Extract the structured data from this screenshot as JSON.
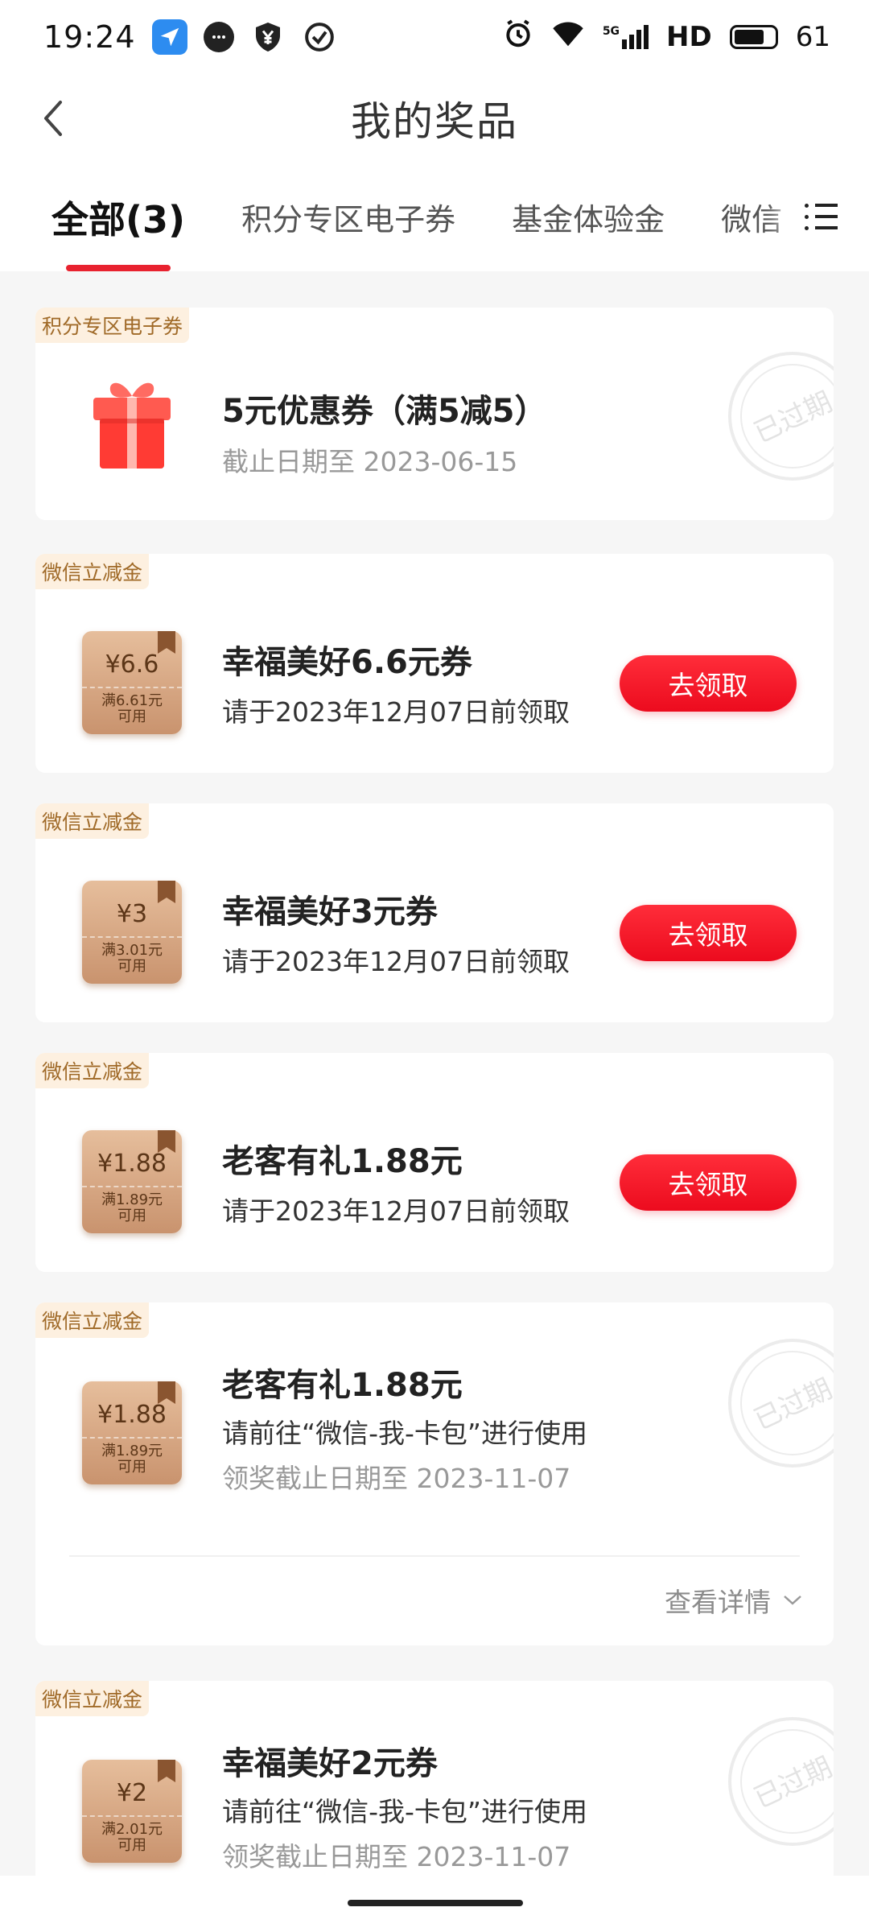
{
  "status_bar": {
    "time": "19:24",
    "network": "5G",
    "hd": "HD",
    "battery": "61",
    "icons": [
      "navigation-icon",
      "message-icon",
      "shield-yen-icon",
      "check-circle-icon",
      "alarm-icon",
      "wifi-icon",
      "signal-icon",
      "battery-icon"
    ]
  },
  "header": {
    "title": "我的奖品",
    "back_icon": "chevron-left-icon"
  },
  "tabs": {
    "items": [
      {
        "label": "全部(3)",
        "active": true
      },
      {
        "label": "积分专区电子券",
        "active": false
      },
      {
        "label": "基金体验金",
        "active": false
      },
      {
        "label": "微信",
        "active": false
      }
    ],
    "menu_icon": "list-icon"
  },
  "cards": [
    {
      "tag": "积分专区电子券",
      "icon": "gift-icon",
      "title": "5元优惠券（满5减5）",
      "date": "截止日期至 2023-06-15",
      "stamp": "已过期"
    },
    {
      "tag": "微信立减金",
      "coupon_amount": "¥6.6",
      "coupon_condition": [
        "满6.61元",
        "可用"
      ],
      "title": "幸福美好6.6元券",
      "sub": "请于2023年12月07日前领取",
      "button": "去领取"
    },
    {
      "tag": "微信立减金",
      "coupon_amount": "¥3",
      "coupon_condition": [
        "满3.01元",
        "可用"
      ],
      "title": "幸福美好3元券",
      "sub": "请于2023年12月07日前领取",
      "button": "去领取"
    },
    {
      "tag": "微信立减金",
      "coupon_amount": "¥1.88",
      "coupon_condition": [
        "满1.89元",
        "可用"
      ],
      "title": "老客有礼1.88元",
      "sub": "请于2023年12月07日前领取",
      "button": "去领取"
    },
    {
      "tag": "微信立减金",
      "coupon_amount": "¥1.88",
      "coupon_condition": [
        "满1.89元",
        "可用"
      ],
      "title": "老客有礼1.88元",
      "sub": "请前往“微信-我-卡包”进行使用",
      "date": "领奖截止日期至 2023-11-07",
      "stamp": "已过期",
      "details": "查看详情"
    },
    {
      "tag": "微信立减金",
      "coupon_amount": "¥2",
      "coupon_condition": [
        "满2.01元",
        "可用"
      ],
      "title": "幸福美好2元券",
      "sub": "请前往“微信-我-卡包”进行使用",
      "date": "领奖截止日期至 2023-11-07",
      "stamp": "已过期"
    }
  ],
  "colors": {
    "accent": "#e8222f",
    "tag_bg": "#fdf0e0",
    "tag_text": "#a06a28",
    "background": "#f6f6f6"
  }
}
